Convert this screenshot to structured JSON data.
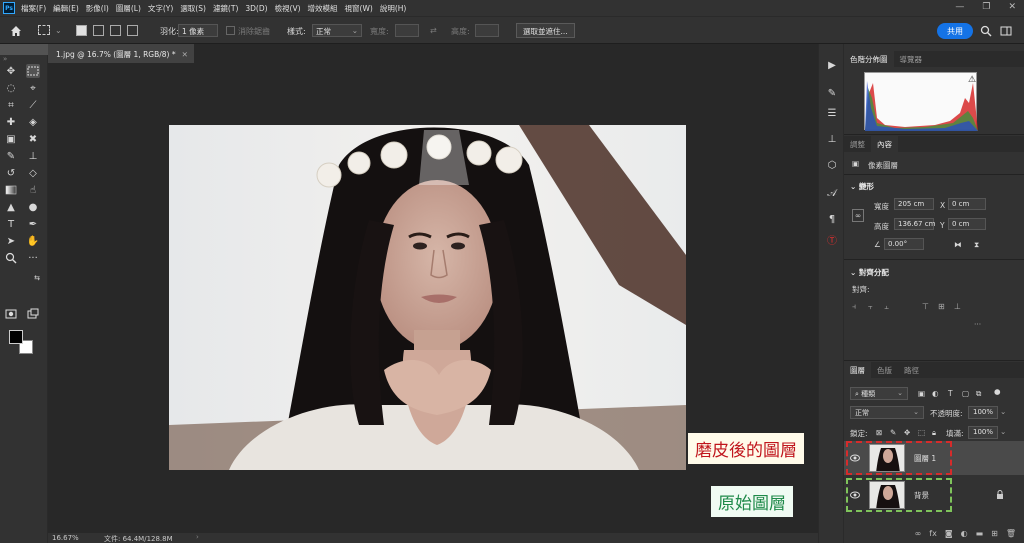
{
  "menu": {
    "items": [
      "檔案(F)",
      "編輯(E)",
      "影像(I)",
      "圖層(L)",
      "文字(Y)",
      "選取(S)",
      "濾鏡(T)",
      "3D(D)",
      "檢視(V)",
      "增效模組",
      "視窗(W)",
      "說明(H)"
    ]
  },
  "options": {
    "feather_label": "羽化:",
    "feather_value": "1 像素",
    "antialias_label": "消除鋸齒",
    "style_label": "樣式:",
    "style_value": "正常",
    "width_label": "寬度:",
    "height_label": "高度:",
    "select_subject": "選取並遮住...",
    "share": "共用"
  },
  "document": {
    "tab_title": "1.jpg @ 16.7% (圖層 1, RGB/8) *",
    "zoom": "16.67%",
    "doc_size": "文件: 64.4M/128.8M"
  },
  "histogram_panel": {
    "tabs": [
      "色階分佈圖",
      "導覽器"
    ]
  },
  "properties_panel": {
    "tabs": [
      "調整",
      "內容"
    ],
    "layer_type": "像素圖層",
    "transform_title": "變形",
    "width_label": "寬度",
    "width_value": "205 cm",
    "height_label": "高度",
    "height_value": "136.67 cm",
    "x_label": "X",
    "x_value": "0 cm",
    "y_label": "Y",
    "y_value": "0 cm",
    "angle_value": "0.00°",
    "align_title": "對齊分配",
    "align_to_label": "對齊:"
  },
  "layers_panel": {
    "tabs": [
      "圖層",
      "色版",
      "路徑"
    ],
    "kind_label": "種類",
    "blend_mode": "正常",
    "opacity_label": "不透明度:",
    "opacity_value": "100%",
    "lock_label": "鎖定:",
    "fill_label": "填滿:",
    "fill_value": "100%",
    "layers": [
      {
        "name": "圖層 1",
        "selected": true
      },
      {
        "name": "背景",
        "selected": false
      }
    ]
  },
  "annotations": {
    "retouched_layer": "磨皮後的圖層",
    "original_layer": "原始圖層"
  },
  "colors": {
    "accent": "#1473e6",
    "annotation_red": "#c0161d",
    "annotation_green": "#1f8a4a"
  }
}
